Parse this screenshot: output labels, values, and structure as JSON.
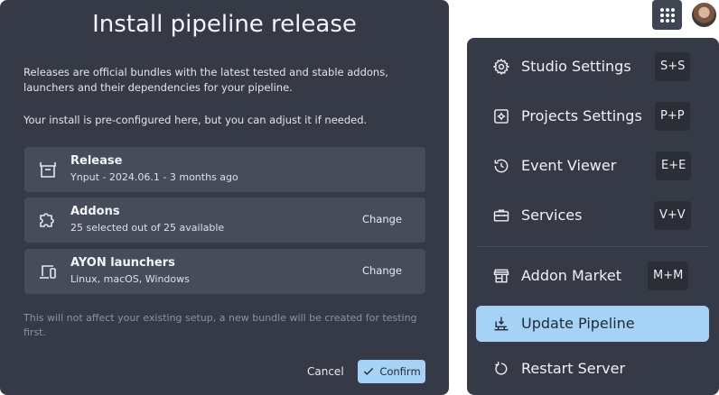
{
  "dialog": {
    "title": "Install pipeline release",
    "intro_1": "Releases are official bundles with the latest tested and stable addons, launchers and their dependencies for your pipeline.",
    "intro_2": "Your install is pre-configured here, but you can adjust it if needed.",
    "rows": [
      {
        "title": "Release",
        "subtitle": "Ynput - 2024.06.1 - 3 months ago",
        "action": "",
        "icon": "release-box-icon"
      },
      {
        "title": "Addons",
        "subtitle": "25 selected out of 25 available",
        "action": "Change",
        "icon": "puzzle-icon"
      },
      {
        "title": "AYON launchers",
        "subtitle": "Linux, macOS, Windows",
        "action": "Change",
        "icon": "devices-icon"
      }
    ],
    "footnote": "This will not affect your existing setup, a new bundle will be created for testing first.",
    "cancel_label": "Cancel",
    "confirm_label": "Confirm"
  },
  "header": {
    "apps_icon": "apps-grid-icon",
    "avatar": "user-avatar"
  },
  "menu": {
    "items": [
      {
        "label": "Studio Settings",
        "shortcut": "S+S",
        "icon": "gear-icon"
      },
      {
        "label": "Projects Settings",
        "shortcut": "P+P",
        "icon": "project-settings-icon"
      },
      {
        "label": "Event Viewer",
        "shortcut": "E+E",
        "icon": "history-icon"
      },
      {
        "label": "Services",
        "shortcut": "V+V",
        "icon": "toolbox-icon"
      },
      {
        "label": "Addon Market",
        "shortcut": "M+M",
        "icon": "store-icon"
      },
      {
        "label": "Update Pipeline",
        "shortcut": "",
        "icon": "install-desktop-icon",
        "active": true
      },
      {
        "label": "Restart Server",
        "shortcut": "",
        "icon": "restart-icon"
      }
    ]
  },
  "colors": {
    "panel": "#353a46",
    "row": "#464c59",
    "accent": "#a6d3f5",
    "shortcut_bg": "#2a2e37"
  }
}
